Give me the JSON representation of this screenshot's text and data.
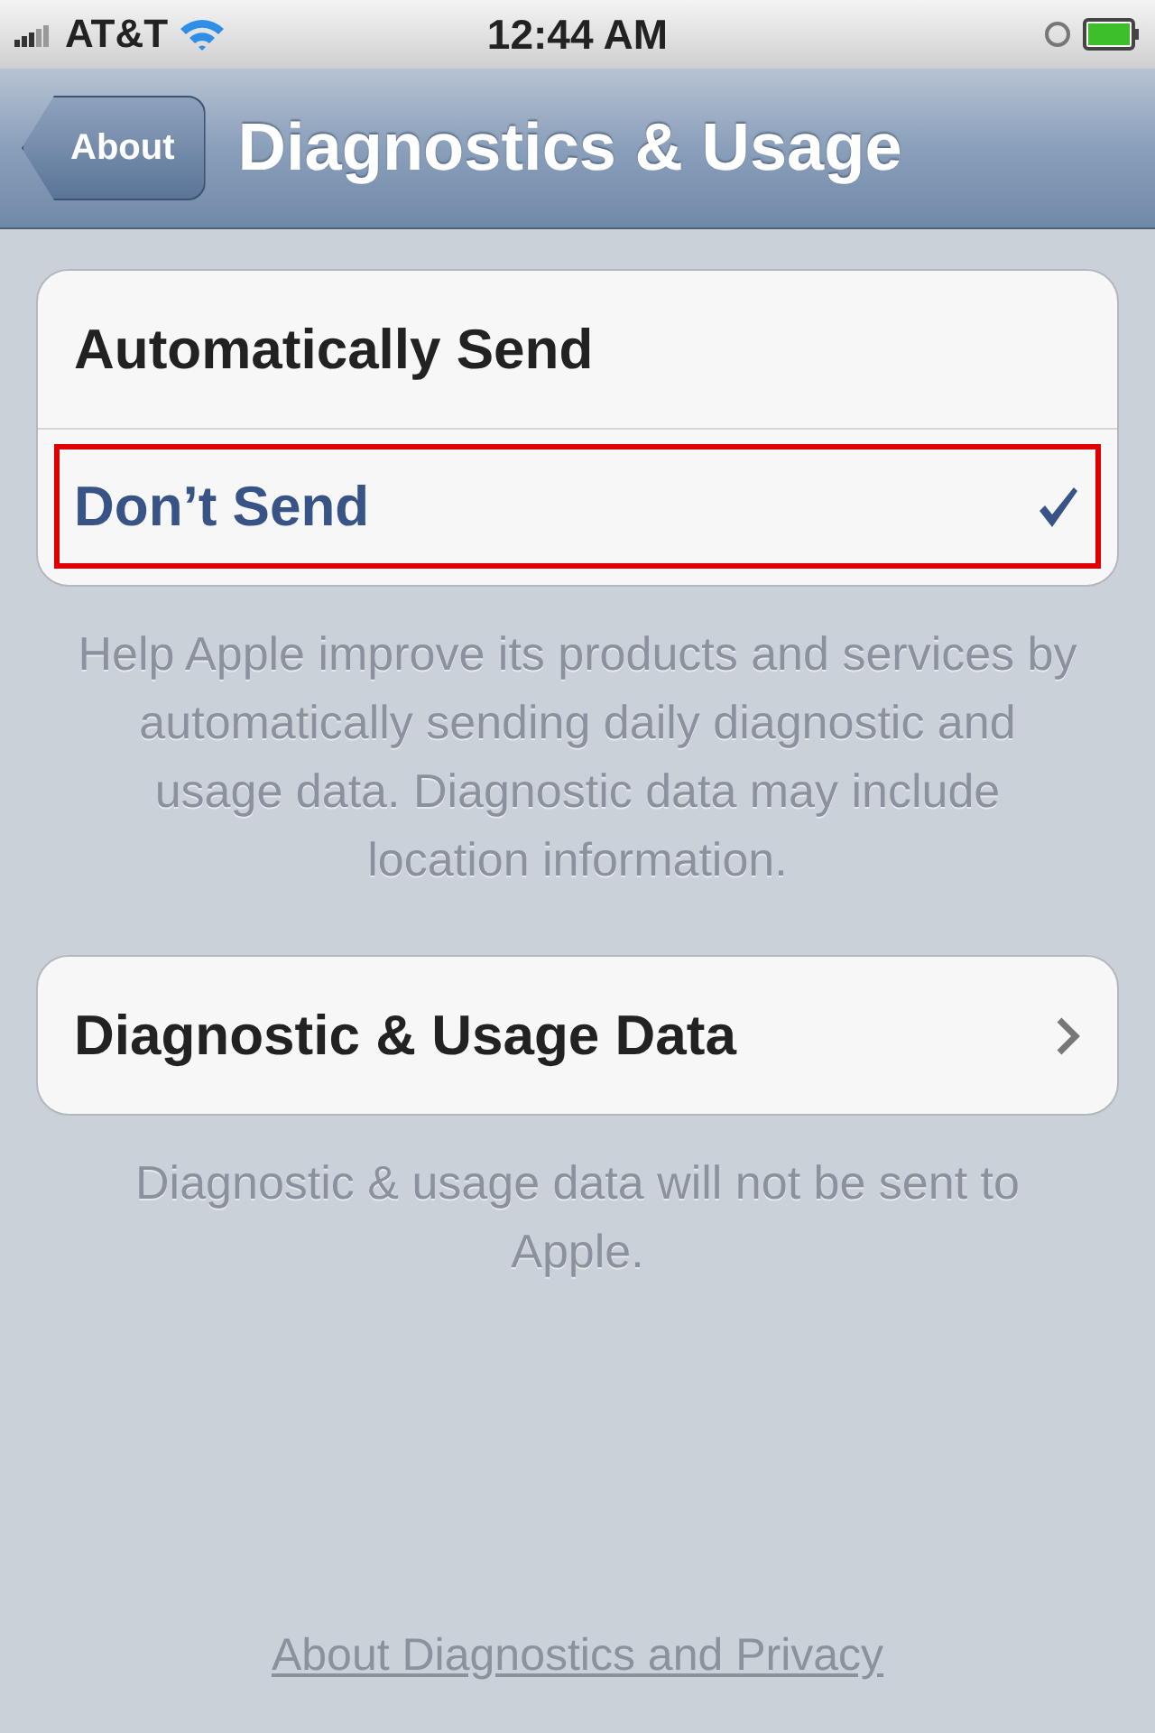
{
  "status_bar": {
    "carrier": "AT&T",
    "time": "12:44 AM"
  },
  "nav_bar": {
    "back_button": "About",
    "title": "Diagnostics & Usage"
  },
  "options": [
    {
      "label": "Automatically Send",
      "selected": false,
      "highlighted": false
    },
    {
      "label": "Don’t Send",
      "selected": true,
      "highlighted": true
    }
  ],
  "options_footer": "Help Apple improve its products and services by automatically sending daily diagnostic and usage data. Diagnostic data may include location information.",
  "data_row": {
    "label": "Diagnostic & Usage Data"
  },
  "data_footer": "Diagnostic & usage data will not be sent to Apple.",
  "link": "About Diagnostics and Privacy"
}
